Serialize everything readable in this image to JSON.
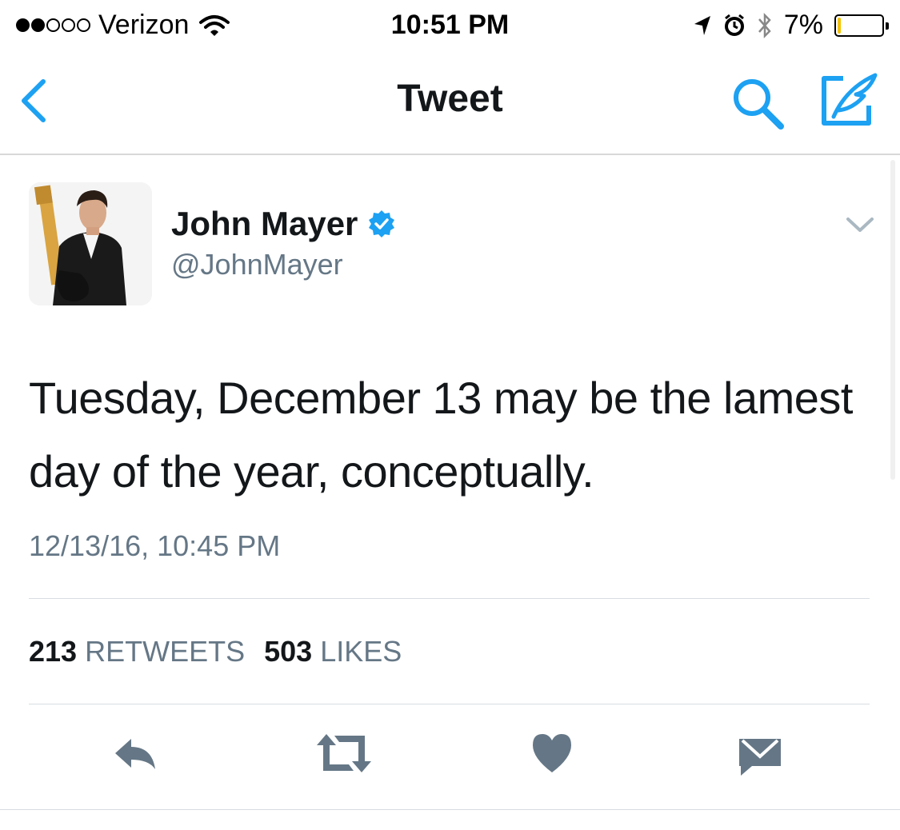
{
  "status_bar": {
    "carrier": "Verizon",
    "time": "10:51 PM",
    "battery_percent": "7%",
    "battery_level": 0.07,
    "signal_bars_filled": 2,
    "signal_bars_total": 5,
    "icons": [
      "wifi-icon",
      "location-arrow-icon",
      "alarm-icon",
      "bluetooth-icon",
      "battery-icon"
    ]
  },
  "nav": {
    "title": "Tweet",
    "accent_color": "#1da1f2",
    "icons": [
      "back-chevron-icon",
      "search-icon",
      "compose-icon"
    ]
  },
  "tweet": {
    "author_name": "John Mayer",
    "author_handle": "@JohnMayer",
    "verified": true,
    "verified_color": "#1da1f2",
    "text": "Tuesday, December 13 may be the lamest day of the year, conceptually.",
    "timestamp": "12/13/16, 10:45 PM",
    "retweets_count": "213",
    "retweets_label": "RETWEETS",
    "likes_count": "503",
    "likes_label": "LIKES"
  },
  "actions": {
    "icon_color": "#657786",
    "icons": [
      "reply-icon",
      "retweet-icon",
      "like-icon",
      "direct-message-icon"
    ]
  }
}
